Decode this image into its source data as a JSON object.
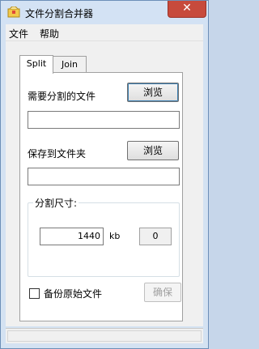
{
  "window": {
    "title": "文件分割合并器",
    "close_label": "✕"
  },
  "menu": {
    "items": [
      "文件",
      "帮助"
    ]
  },
  "tabs": [
    "Split",
    "Join"
  ],
  "split": {
    "source_label": "需要分割的文件",
    "browse_label": "浏览",
    "source_value": "",
    "dest_label": "保存到文件夹",
    "dest_browse_label": "浏览",
    "dest_value": "",
    "size_group_title": "分割尺寸:",
    "size_value": "1440",
    "size_unit": "kb",
    "count_value": "0",
    "backup_label": "备份原始文件",
    "backup_checked": false,
    "confirm_label": "确保"
  },
  "colors": {
    "title_bg": "#d3e2f4",
    "close_red": "#c74a3c",
    "panel_bg": "#f0f0f0"
  }
}
